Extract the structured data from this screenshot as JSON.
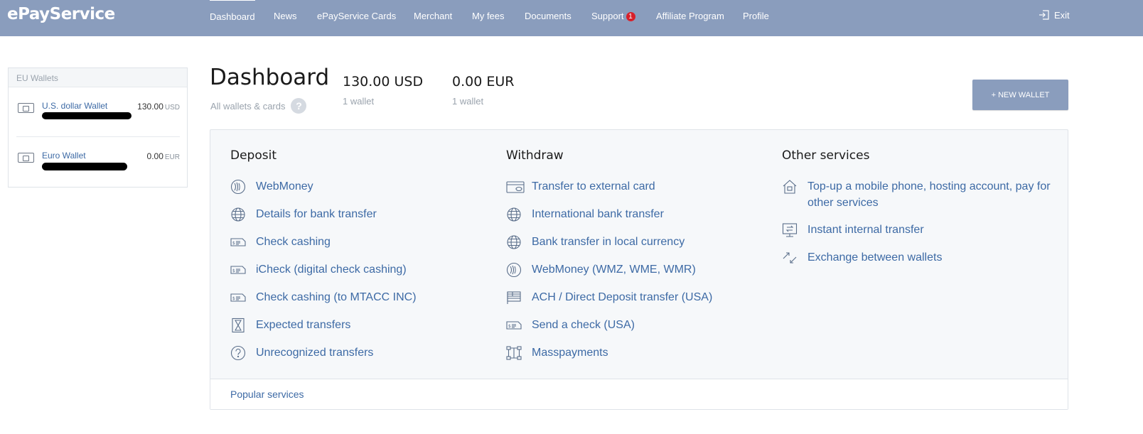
{
  "header": {
    "logo": "ePayService",
    "nav": [
      {
        "label": "Dashboard",
        "active": true
      },
      {
        "label": "News"
      },
      {
        "label": "ePayService Cards"
      },
      {
        "label": "Merchant"
      },
      {
        "label": "My fees"
      },
      {
        "label": "Documents"
      },
      {
        "label": "Support",
        "badge": "1"
      },
      {
        "label": "Affiliate Program"
      },
      {
        "label": "Profile"
      }
    ],
    "exit_label": "Exit"
  },
  "sidebar": {
    "title": "EU Wallets",
    "wallets": [
      {
        "name": "U.S. dollar Wallet",
        "amount": "130.00",
        "currency": "USD"
      },
      {
        "name": "Euro Wallet",
        "amount": "0.00",
        "currency": "EUR"
      }
    ]
  },
  "dashboard": {
    "title": "Dashboard",
    "subtitle": "All wallets & cards",
    "help": "?",
    "totals": [
      {
        "amount": "130.00 USD",
        "count": "1 wallet"
      },
      {
        "amount": "0.00 EUR",
        "count": "1 wallet"
      }
    ],
    "new_wallet_label": "+ NEW WALLET"
  },
  "services": {
    "deposit": {
      "title": "Deposit",
      "items": [
        {
          "label": "WebMoney",
          "icon": "webmoney-icon"
        },
        {
          "label": "Details for bank transfer",
          "icon": "globe-icon"
        },
        {
          "label": "Check cashing",
          "icon": "check-icon"
        },
        {
          "label": "iCheck (digital check cashing)",
          "icon": "check-icon"
        },
        {
          "label": "Check cashing (to MTACC INC)",
          "icon": "check-icon"
        },
        {
          "label": "Expected transfers",
          "icon": "hourglass-icon"
        },
        {
          "label": "Unrecognized transfers",
          "icon": "question-icon"
        }
      ]
    },
    "withdraw": {
      "title": "Withdraw",
      "items": [
        {
          "label": "Transfer to external card",
          "icon": "card-icon"
        },
        {
          "label": "International bank transfer",
          "icon": "globe-icon"
        },
        {
          "label": "Bank transfer in local currency",
          "icon": "globe-icon"
        },
        {
          "label": "WebMoney (WMZ, WME, WMR)",
          "icon": "webmoney-icon"
        },
        {
          "label": "ACH / Direct Deposit transfer (USA)",
          "icon": "flag-icon"
        },
        {
          "label": "Send a check (USA)",
          "icon": "check-icon"
        },
        {
          "label": "Masspayments",
          "icon": "masspayments-icon"
        }
      ]
    },
    "other": {
      "title": "Other services",
      "items": [
        {
          "label": "Top-up a mobile phone, hosting account, pay for other services",
          "icon": "house-icon"
        },
        {
          "label": "Instant internal transfer",
          "icon": "internal-transfer-icon"
        },
        {
          "label": "Exchange between wallets",
          "icon": "exchange-icon"
        }
      ]
    },
    "popular_label": "Popular services"
  },
  "colors": {
    "header_bg": "#8a9dbd",
    "link": "#3d6aa5",
    "badge": "#d8202a"
  }
}
